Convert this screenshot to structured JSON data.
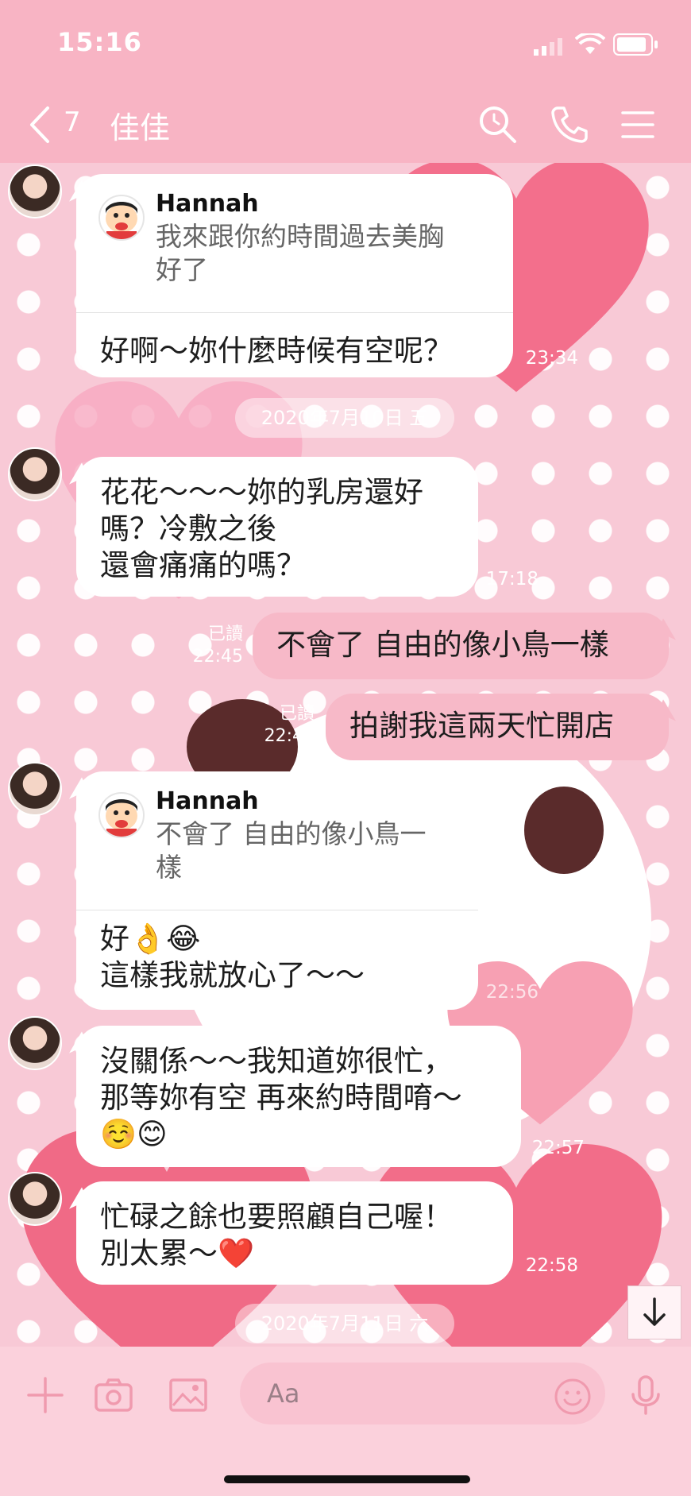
{
  "status": {
    "time": "15:16"
  },
  "header": {
    "unread_count": "7",
    "title": "佳佳"
  },
  "messages": [
    {
      "id": "m1",
      "quote": {
        "name": "Hannah",
        "text": "我來跟你約時間過去美胸\n好了"
      },
      "text": "好啊～妳什麼時候有空呢？",
      "time": "23:34"
    },
    {
      "id": "date1",
      "date": "2020年7月10日 五"
    },
    {
      "id": "m2",
      "text": "花花～～～妳的乳房還好\n嗎？冷敷之後\n還會痛痛的嗎？",
      "time": "17:18"
    },
    {
      "id": "m3",
      "text": "不會了 自由的像小鳥一樣",
      "read": "已讀",
      "time": "22:45"
    },
    {
      "id": "m4",
      "text": "拍謝我這兩天忙開店",
      "read": "已讀",
      "time": "22:45"
    },
    {
      "id": "m5",
      "quote": {
        "name": "Hannah",
        "text": "不會了 自由的像小鳥一\n樣"
      },
      "text": "好👌😂\n這樣我就放心了～～",
      "time": "22:56"
    },
    {
      "id": "m6",
      "text": "沒關係～～我知道妳很忙，\n那等妳有空 再來約時間唷～\n☺️😊",
      "time": "22:57"
    },
    {
      "id": "m7",
      "text": "忙碌之餘也要照顧自己喔！\n別太累～❤️",
      "time": "22:58"
    },
    {
      "id": "date2",
      "date": "2020年7月11日 六"
    }
  ],
  "input": {
    "placeholder": "Aa"
  },
  "colors": {
    "header": "#f8b4c4",
    "bubble_out": "#f7b9c8",
    "bubble_in": "#ffffff",
    "input_bar": "#fbd1dc"
  },
  "icons": [
    "back-chevron-icon",
    "search-icon",
    "phone-icon",
    "menu-icon",
    "plus-icon",
    "camera-icon",
    "image-icon",
    "emoji-icon",
    "microphone-icon",
    "arrow-down-icon",
    "signal-icon",
    "wifi-icon",
    "battery-icon"
  ]
}
